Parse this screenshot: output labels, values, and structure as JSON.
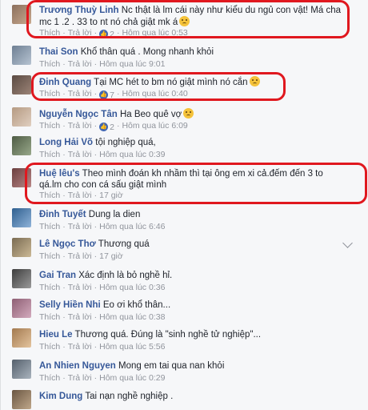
{
  "common": {
    "like": "Thích",
    "reply": "Trả lời",
    "dot": "·"
  },
  "comments": [
    {
      "name": "Trương Thuỳ Linh",
      "text": "Nc thật là lm cái này như kiểu du ngủ con vật! Má cha mc 1 .2 . 33 to nt nó chả giật mk á",
      "likes": "2",
      "time": "Hôm qua lúc 0:53",
      "emoji": "sad-emoji"
    },
    {
      "name": "Thai Son",
      "text": "Khổ thân quá . Mong nhanh khỏi",
      "likes": "",
      "time": "Hôm qua lúc 9:01",
      "emoji": ""
    },
    {
      "name": "Đinh Quang",
      "text": "Tại MC hét to bm nó giật mình nó cắn",
      "likes": "7",
      "time": "Hôm qua lúc 0:40",
      "emoji": "angry-emoji"
    },
    {
      "name": "Nguyễn Ngọc Tân",
      "text": "Ha Beo quê vợ",
      "likes": "2",
      "time": "Hôm qua lúc 6:09",
      "emoji": "smile-emoji"
    },
    {
      "name": "Long Hải Võ",
      "text": "tội nghiệp quá,",
      "likes": "",
      "time": "Hôm qua lúc 0:39",
      "emoji": ""
    },
    {
      "name": "Huệ lêu's",
      "text": "Theo mình đoán kh nhầm thì tại ông em xi cả.đếm đến 3 to qá.lm cho con cá sấu giật mình",
      "likes": "",
      "time": "17 giờ",
      "emoji": ""
    },
    {
      "name": "Đinh Tuyết",
      "text": "Dung la dien",
      "likes": "",
      "time": "Hôm qua lúc 6:46",
      "emoji": ""
    },
    {
      "name": "Lê Ngọc Thơ",
      "text": "Thương quá",
      "likes": "",
      "time": "17 giờ",
      "emoji": ""
    },
    {
      "name": "Gai Tran",
      "text": "Xác định là bỏ nghề hỉ.",
      "likes": "",
      "time": "Hôm qua lúc 0:36",
      "emoji": ""
    },
    {
      "name": "Selly Hiền Nhi",
      "text": "Eo ơi khổ thân...",
      "likes": "",
      "time": "Hôm qua lúc 0:38",
      "emoji": ""
    },
    {
      "name": "Hieu Le",
      "text": "Thương quá. Đúng là \"sinh nghề tử nghiệp\"...",
      "likes": "",
      "time": "Hôm qua lúc 5:56",
      "emoji": ""
    },
    {
      "name": "An Nhien Nguyen",
      "text": "Mong em tai qua nan khỏi",
      "likes": "",
      "time": "Hôm qua lúc 0:29",
      "emoji": ""
    },
    {
      "name": "Kim Dung",
      "text": "Tai nạn nghề nghiệp .",
      "likes": "",
      "time": "",
      "emoji": ""
    }
  ]
}
